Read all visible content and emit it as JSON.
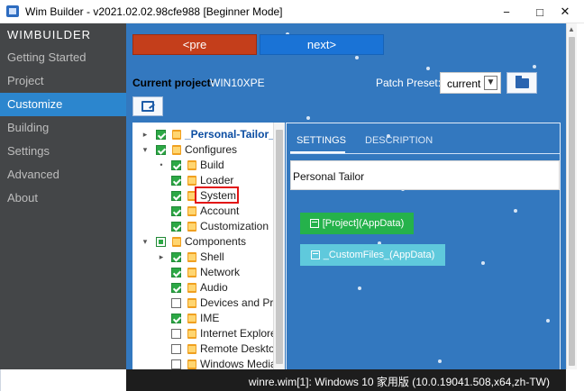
{
  "window": {
    "title": "Wim Builder - v2021.02.02.98cfe988 [Beginner Mode]",
    "controls": [
      "−",
      "□",
      "✕"
    ]
  },
  "sidebar": {
    "brand": "WIMBUILDER",
    "items": [
      {
        "label": "Getting Started"
      },
      {
        "label": "Project"
      },
      {
        "label": "Customize"
      },
      {
        "label": "Building"
      },
      {
        "label": "Settings"
      },
      {
        "label": "Advanced"
      },
      {
        "label": "About"
      }
    ]
  },
  "nav": {
    "pre_label": "<pre",
    "next_label": "next>"
  },
  "project": {
    "current_label": "Current project:",
    "current_value": "WIN10XPE",
    "patch_label": "Patch Preset:",
    "patch_value": "current"
  },
  "tree": {
    "items": [
      {
        "label": "_Personal-Tailor_(AppData)"
      },
      {
        "label": "Configures"
      },
      {
        "label": "Build"
      },
      {
        "label": "Loader"
      },
      {
        "label": "System"
      },
      {
        "label": "Account"
      },
      {
        "label": "Customization"
      },
      {
        "label": "Components"
      },
      {
        "label": "Shell"
      },
      {
        "label": "Network"
      },
      {
        "label": "Audio"
      },
      {
        "label": "Devices and Printers"
      },
      {
        "label": "IME"
      },
      {
        "label": "Internet Explorer"
      },
      {
        "label": "Remote Desktop"
      },
      {
        "label": "Windows Media"
      }
    ]
  },
  "details": {
    "tab_settings": "SETTINGS",
    "tab_description": "DESCRIPTION",
    "project_name": "Personal Tailor",
    "appdata_button": "[Project](AppData)",
    "custom_button": "_CustomFiles_(AppData)"
  },
  "status": {
    "text": "winre.wim[1]: Windows 10 家用版 (10.0.19041.508,x64,zh-TW)"
  },
  "colors": {
    "sidebar_bg": "#444648",
    "accent": "#2c86ce",
    "main_bg": "#3378bf",
    "pre_button": "#c43e1b",
    "next_button": "#1a73d6"
  }
}
